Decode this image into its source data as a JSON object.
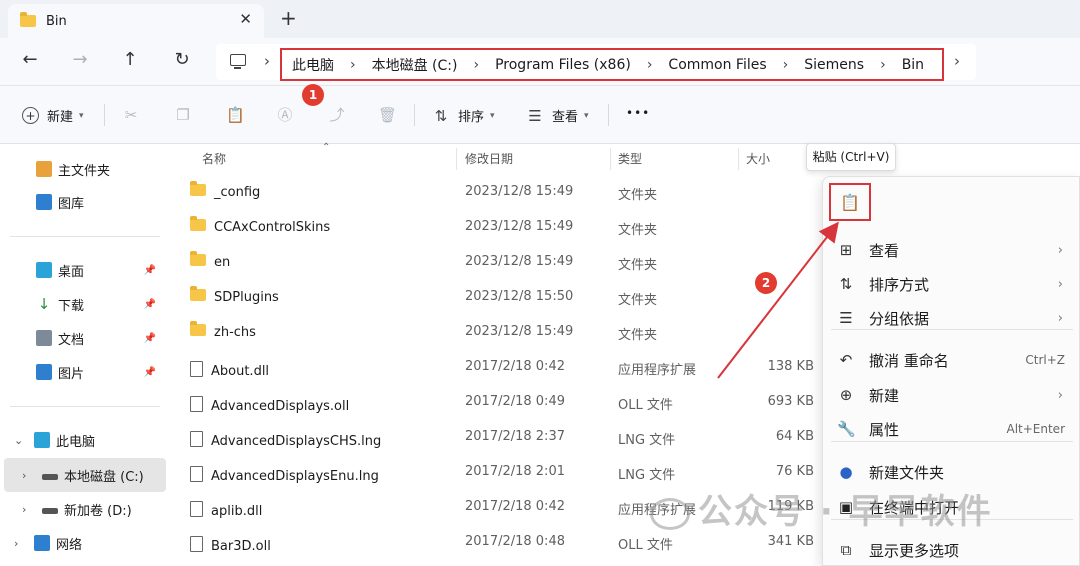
{
  "window": {
    "tab_title": "Bin",
    "new_tab": "+",
    "close": "✕"
  },
  "nav": {
    "back": "←",
    "forward": "→",
    "up": "↑",
    "refresh": "↻",
    "breadcrumbs": [
      "此电脑",
      "本地磁盘 (C:)",
      "Program Files (x86)",
      "Common Files",
      "Siemens",
      "Bin"
    ],
    "separator": "›"
  },
  "toolbar": {
    "new_label": "新建",
    "sort_label": "排序",
    "view_label": "查看",
    "more": "•••"
  },
  "sidebar": {
    "quick": [
      {
        "label": "主文件夹",
        "icon": "home-icon",
        "color": "#e9a23b"
      },
      {
        "label": "图库",
        "icon": "gallery-icon",
        "color": "#2f7fd1"
      }
    ],
    "pinned": [
      {
        "label": "桌面",
        "icon": "desktop-icon",
        "color": "#2aa3d8"
      },
      {
        "label": "下载",
        "icon": "download-icon",
        "color": "#2b8a3e"
      },
      {
        "label": "文档",
        "icon": "documents-icon",
        "color": "#7d8a99"
      },
      {
        "label": "图片",
        "icon": "pictures-icon",
        "color": "#2f7fd1"
      }
    ],
    "tree": [
      {
        "label": "此电脑",
        "chevron": "⌄"
      },
      {
        "label": "本地磁盘 (C:)",
        "chevron": "›"
      },
      {
        "label": "新加卷 (D:)",
        "chevron": "›"
      },
      {
        "label": "网络",
        "chevron": "›"
      }
    ]
  },
  "columns": {
    "name": "名称",
    "modified": "修改日期",
    "type": "类型",
    "size": "大小"
  },
  "files": [
    {
      "name": "_config",
      "date": "2023/12/8 15:49",
      "type": "文件夹",
      "size": "",
      "kind": "folder"
    },
    {
      "name": "CCAxControlSkins",
      "date": "2023/12/8 15:49",
      "type": "文件夹",
      "size": "",
      "kind": "folder"
    },
    {
      "name": "en",
      "date": "2023/12/8 15:49",
      "type": "文件夹",
      "size": "",
      "kind": "folder"
    },
    {
      "name": "SDPlugins",
      "date": "2023/12/8 15:50",
      "type": "文件夹",
      "size": "",
      "kind": "folder"
    },
    {
      "name": "zh-chs",
      "date": "2023/12/8 15:49",
      "type": "文件夹",
      "size": "",
      "kind": "folder"
    },
    {
      "name": "About.dll",
      "date": "2017/2/18 0:42",
      "type": "应用程序扩展",
      "size": "138 KB",
      "kind": "file"
    },
    {
      "name": "AdvancedDisplays.oll",
      "date": "2017/2/18 0:49",
      "type": "OLL 文件",
      "size": "693 KB",
      "kind": "file"
    },
    {
      "name": "AdvancedDisplaysCHS.lng",
      "date": "2017/2/18 2:37",
      "type": "LNG 文件",
      "size": "64 KB",
      "kind": "file"
    },
    {
      "name": "AdvancedDisplaysEnu.lng",
      "date": "2017/2/18 2:01",
      "type": "LNG 文件",
      "size": "76 KB",
      "kind": "file"
    },
    {
      "name": "aplib.dll",
      "date": "2017/2/18 0:42",
      "type": "应用程序扩展",
      "size": "119 KB",
      "kind": "file"
    },
    {
      "name": "Bar3D.oll",
      "date": "2017/2/18 0:48",
      "type": "OLL 文件",
      "size": "341 KB",
      "kind": "file"
    }
  ],
  "context_menu": {
    "tooltip": "粘贴 (Ctrl+V)",
    "items": [
      {
        "label": "查看",
        "icon": "grid-icon",
        "glyph": "⊞",
        "shortcut": "",
        "submenu": true
      },
      {
        "label": "排序方式",
        "icon": "sort-icon",
        "glyph": "⇅",
        "shortcut": "",
        "submenu": true
      },
      {
        "label": "分组依据",
        "icon": "group-icon",
        "glyph": "☰",
        "shortcut": "",
        "submenu": true
      },
      {
        "label": "撤消 重命名",
        "icon": "undo-icon",
        "glyph": "↶",
        "shortcut": "Ctrl+Z",
        "submenu": false
      },
      {
        "label": "新建",
        "icon": "new-icon",
        "glyph": "⊕",
        "shortcut": "",
        "submenu": true
      },
      {
        "label": "属性",
        "icon": "wrench-icon",
        "glyph": "🔧",
        "shortcut": "Alt+Enter",
        "submenu": false
      },
      {
        "label": "新建文件夹",
        "icon": "new-folder-icon",
        "glyph": "●",
        "shortcut": "",
        "submenu": false
      },
      {
        "label": "在终端中打开",
        "icon": "terminal-icon",
        "glyph": "▣",
        "shortcut": "",
        "submenu": false
      },
      {
        "label": "显示更多选项",
        "icon": "more-options-icon",
        "glyph": "⧉",
        "shortcut": "",
        "submenu": false
      }
    ]
  },
  "annotations": {
    "badge1": "1",
    "badge2": "2",
    "color": "#d8343b"
  },
  "watermark": "公众号 · 早早软件"
}
